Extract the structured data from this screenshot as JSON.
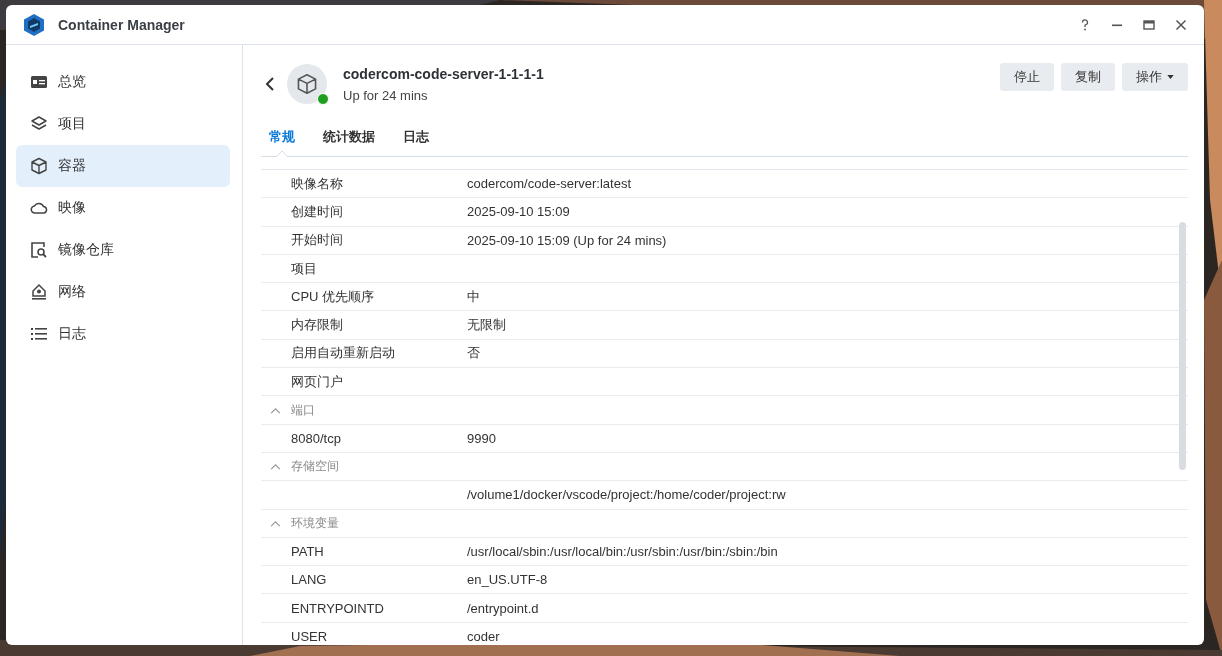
{
  "window": {
    "title": "Container Manager"
  },
  "sidebar": {
    "items": [
      {
        "label": "总览",
        "selected": false
      },
      {
        "label": "项目",
        "selected": false
      },
      {
        "label": "容器",
        "selected": true
      },
      {
        "label": "映像",
        "selected": false
      },
      {
        "label": "镜像仓库",
        "selected": false
      },
      {
        "label": "网络",
        "selected": false
      },
      {
        "label": "日志",
        "selected": false
      }
    ]
  },
  "container": {
    "name": "codercom-code-server-1-1-1-1",
    "status": "Up for 24 mins",
    "running": true
  },
  "buttons": [
    {
      "label": "停止",
      "dropdown": false
    },
    {
      "label": "复制",
      "dropdown": false
    },
    {
      "label": "操作",
      "dropdown": true
    }
  ],
  "tabs": [
    {
      "label": "常规",
      "selected": true
    },
    {
      "label": "统计数据",
      "selected": false
    },
    {
      "label": "日志",
      "selected": false
    }
  ],
  "rows": [
    {
      "kind": "field",
      "label": "映像名称",
      "value": "codercom/code-server:latest"
    },
    {
      "kind": "field",
      "label": "创建时间",
      "value": "2025-09-10 15:09"
    },
    {
      "kind": "field",
      "label": "开始时间",
      "value": "2025-09-10 15:09 (Up for 24 mins)"
    },
    {
      "kind": "field",
      "label": "项目"
    },
    {
      "kind": "field",
      "label": "CPU 优先顺序",
      "value": "中"
    },
    {
      "kind": "field",
      "label": "内存限制",
      "value": "无限制"
    },
    {
      "kind": "field",
      "label": "启用自动重新启动",
      "value": "否"
    },
    {
      "kind": "field",
      "label": "网页门户"
    },
    {
      "kind": "section",
      "label": "端口",
      "expanded": true,
      "children": [
        {
          "kind": "field",
          "label": "8080/tcp",
          "value": "9990"
        }
      ]
    },
    {
      "kind": "section",
      "label": "存储空间",
      "expanded": true,
      "children": [
        {
          "kind": "field",
          "value": "/volume1/docker/vscode/project:/home/coder/project:rw"
        }
      ]
    },
    {
      "kind": "section",
      "label": "环境变量",
      "expanded": true,
      "children": [
        {
          "kind": "field",
          "label": "PATH",
          "value": "/usr/local/sbin:/usr/local/bin:/usr/sbin:/usr/bin:/sbin:/bin"
        },
        {
          "kind": "field",
          "label": "LANG",
          "value": "en_US.UTF-8"
        },
        {
          "kind": "field",
          "label": "ENTRYPOINTD",
          "value": "/entrypoint.d"
        },
        {
          "kind": "field",
          "label": "USER",
          "value": "coder"
        }
      ]
    }
  ]
}
